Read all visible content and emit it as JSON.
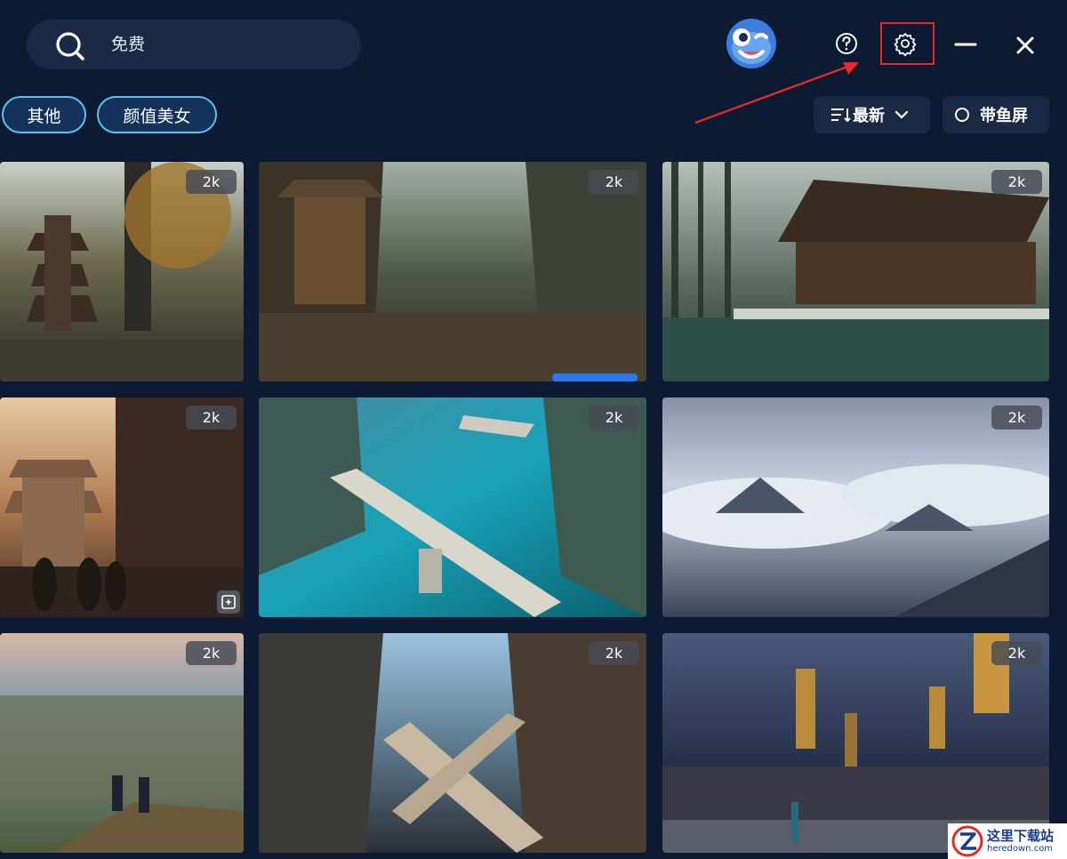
{
  "search": {
    "value": "免费",
    "icon": "search-icon"
  },
  "header": {
    "icons": [
      "help-icon",
      "settings-icon",
      "minimize-icon",
      "close-icon"
    ]
  },
  "categories": [
    {
      "label": "其他"
    },
    {
      "label": "颜值美女"
    }
  ],
  "sort": {
    "label": "最新"
  },
  "fish_screen": {
    "label": "带鱼屏"
  },
  "wallpapers": [
    {
      "badge": "2k",
      "subject": "pagoda-in-mountain-forest"
    },
    {
      "badge": "2k",
      "subject": "crowded-canyon-market-town"
    },
    {
      "badge": "2k",
      "subject": "bamboo-forest-pavilion-by-water"
    },
    {
      "badge": "2k",
      "subject": "sunset-pagoda-street-crowd"
    },
    {
      "badge": "2k",
      "subject": "turquoise-water-bridge-ruins"
    },
    {
      "badge": "2k",
      "subject": "sea-of-clouds-mountains"
    },
    {
      "badge": "2k",
      "subject": "travelers-overlooking-valley"
    },
    {
      "badge": "2k",
      "subject": "floating-city-cross-bridge"
    },
    {
      "badge": "2k",
      "subject": "hanging-lanterns-night-street"
    }
  ],
  "watermark": {
    "text": "这里下载站",
    "site": "heredown.com"
  },
  "colors": {
    "background": "#0c1a33",
    "panel": "#1a2944",
    "chip_border": "#5ec3e8",
    "annotation_red": "#e52b25"
  }
}
